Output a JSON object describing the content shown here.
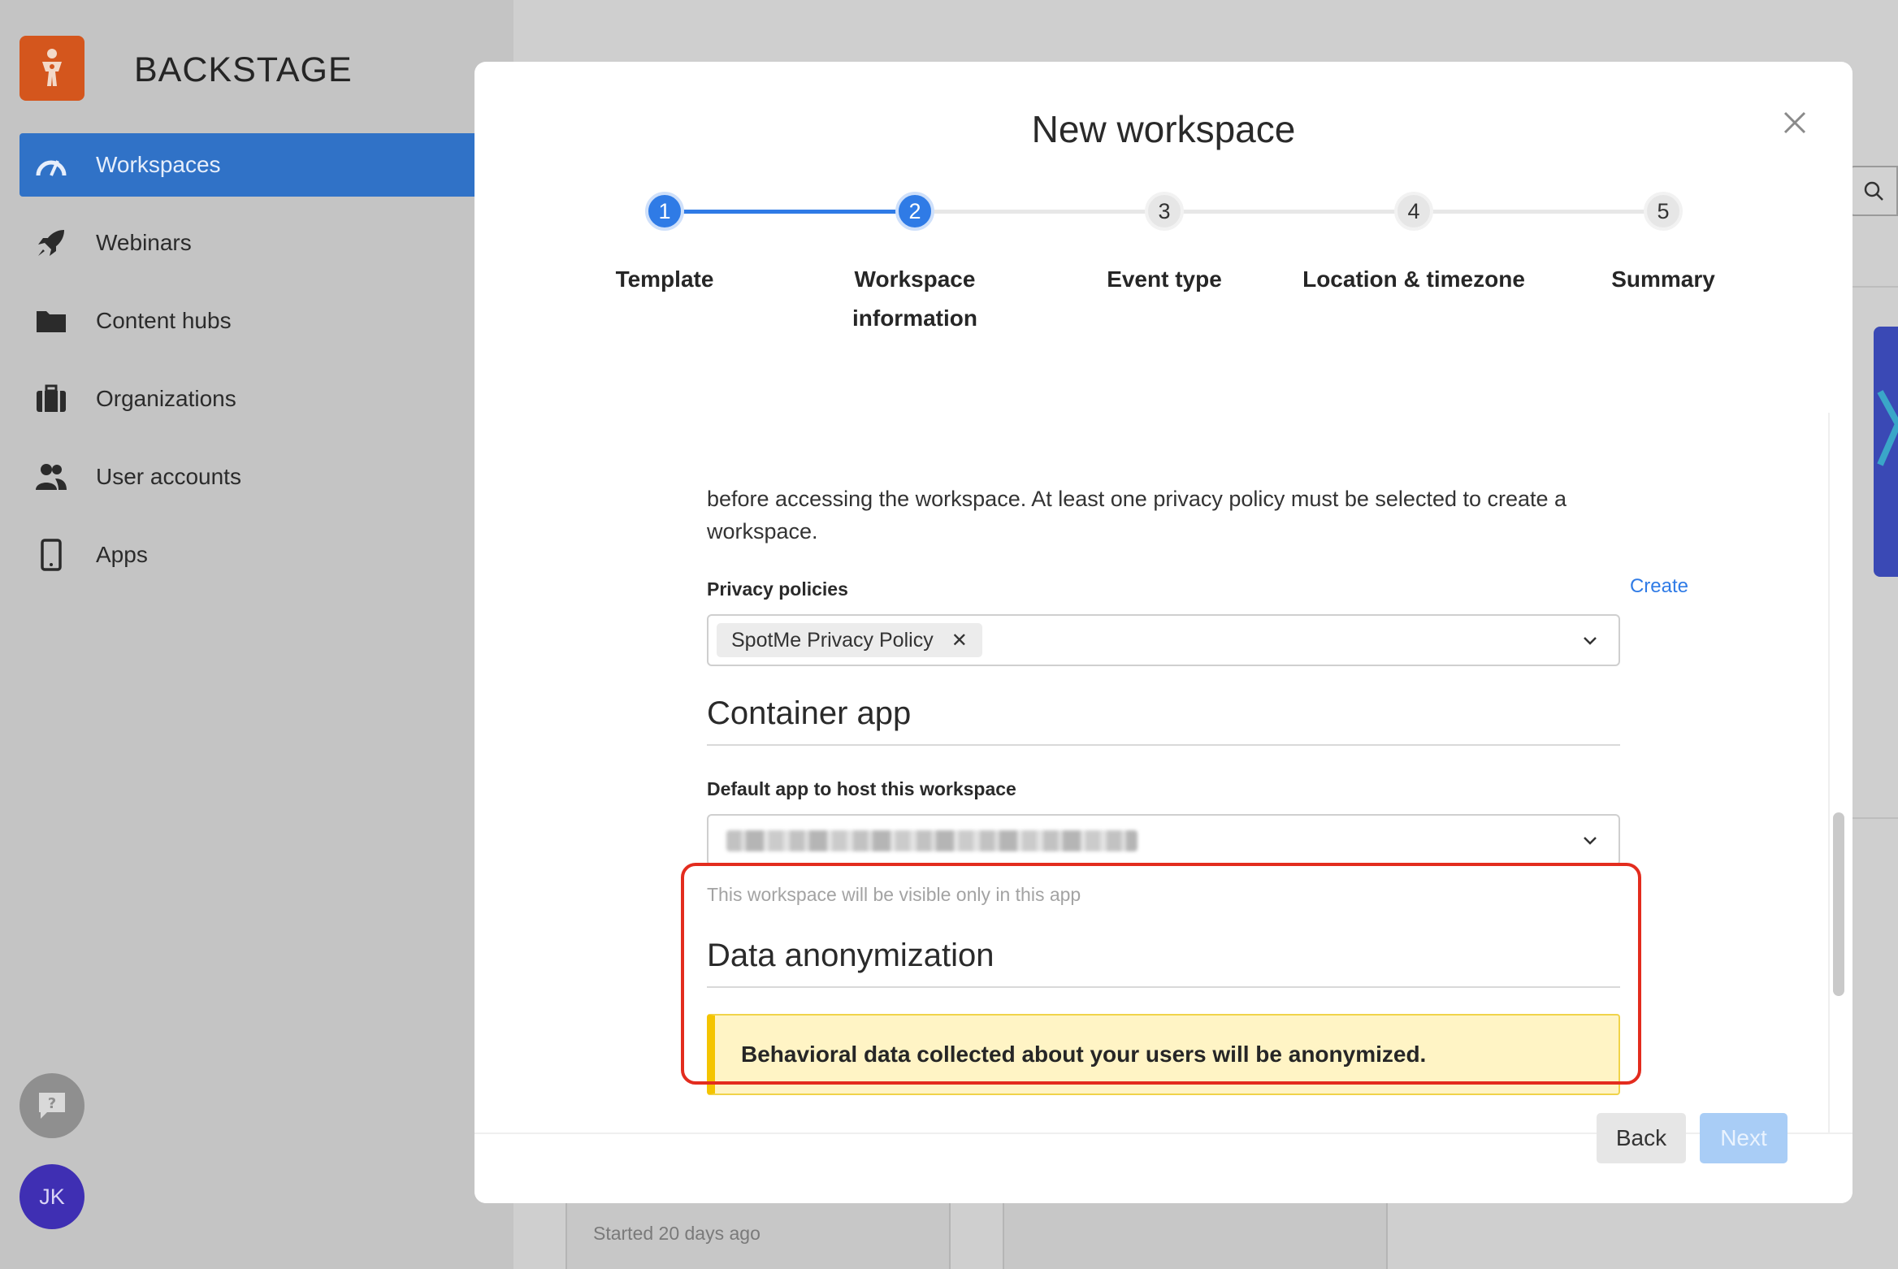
{
  "brand": {
    "name": "BACKSTAGE",
    "color": "#d4561d"
  },
  "sidebar": {
    "items": [
      {
        "label": "Workspaces",
        "icon": "speedometer-icon",
        "active": true
      },
      {
        "label": "Webinars",
        "icon": "rocket-icon",
        "active": false
      },
      {
        "label": "Content hubs",
        "icon": "folder-icon",
        "active": false
      },
      {
        "label": "Organizations",
        "icon": "briefcase-icon",
        "active": false
      },
      {
        "label": "User accounts",
        "icon": "users-icon",
        "active": false
      },
      {
        "label": "Apps",
        "icon": "phone-icon",
        "active": false
      }
    ],
    "help_icon": "help-chat-icon",
    "avatar_initials": "JK"
  },
  "background": {
    "card_status": "Started 20 days ago"
  },
  "modal": {
    "title": "New workspace",
    "steps": [
      {
        "number": "1",
        "label": "Template",
        "state": "done"
      },
      {
        "number": "2",
        "label": "Workspace information",
        "state": "current"
      },
      {
        "number": "3",
        "label": "Event type",
        "state": "todo"
      },
      {
        "number": "4",
        "label": "Location & timezone",
        "state": "todo"
      },
      {
        "number": "5",
        "label": "Summary",
        "state": "todo"
      }
    ],
    "privacy": {
      "description": "before accessing the workspace. At least one privacy policy must be selected to create a workspace.",
      "label": "Privacy policies",
      "create_link": "Create",
      "selected_chip": "SpotMe Privacy Policy"
    },
    "container_app": {
      "title": "Container app",
      "label": "Default app to host this workspace",
      "hint": "This workspace will be visible only in this app"
    },
    "anonymization": {
      "title": "Data anonymization",
      "alert": "Behavioral data collected about your users will be anonymized."
    },
    "footer": {
      "back_label": "Back",
      "next_label": "Next"
    }
  },
  "colors": {
    "accent": "#2f7be6",
    "sidebar_active": "#3072c7",
    "warning_bg": "#fff4c5",
    "warning_border": "#f4c400",
    "highlight": "#e32c1e"
  }
}
